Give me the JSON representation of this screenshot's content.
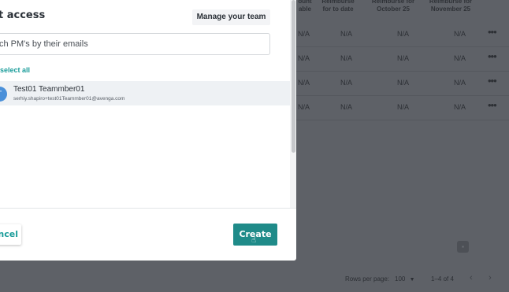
{
  "table": {
    "headers": [
      {
        "label": "ount\nable"
      },
      {
        "label": "Reimburse\nfor to date"
      },
      {
        "label": "Reimburse for\nOctober 25"
      },
      {
        "label": "Reimburse for\nNovember 25"
      }
    ],
    "rows": [
      [
        "N/A",
        "N/A",
        "N/A",
        "N/A"
      ],
      [
        "N/A",
        "N/A",
        "N/A",
        "N/A"
      ],
      [
        "N/A",
        "N/A",
        "N/A",
        "N/A"
      ],
      [
        "N/A",
        "N/A",
        "N/A",
        "N/A"
      ]
    ],
    "more_icon": "•••",
    "footer": {
      "rows_per_page_label": "Rows per page:",
      "rows_per_page_value": "100",
      "range": "1–4 of 4",
      "prev_icon": "‹",
      "next_icon": "›"
    }
  },
  "modal": {
    "title": "t access",
    "manage_button": "Manage your team",
    "search_placeholder": "ch PM's by their emails",
    "select_all": "select all",
    "person": {
      "initial": "T",
      "name": "Test01 Teammber01",
      "email": "serhiy.shapiro+test01Teammber01@avenga.com"
    },
    "cancel_button": "ncel",
    "create_button": "Create"
  },
  "colors": {
    "accent": "#1f8b89",
    "link": "#1a9c9a",
    "avatar": "#4a90d9",
    "overlay": "#5e6167"
  }
}
